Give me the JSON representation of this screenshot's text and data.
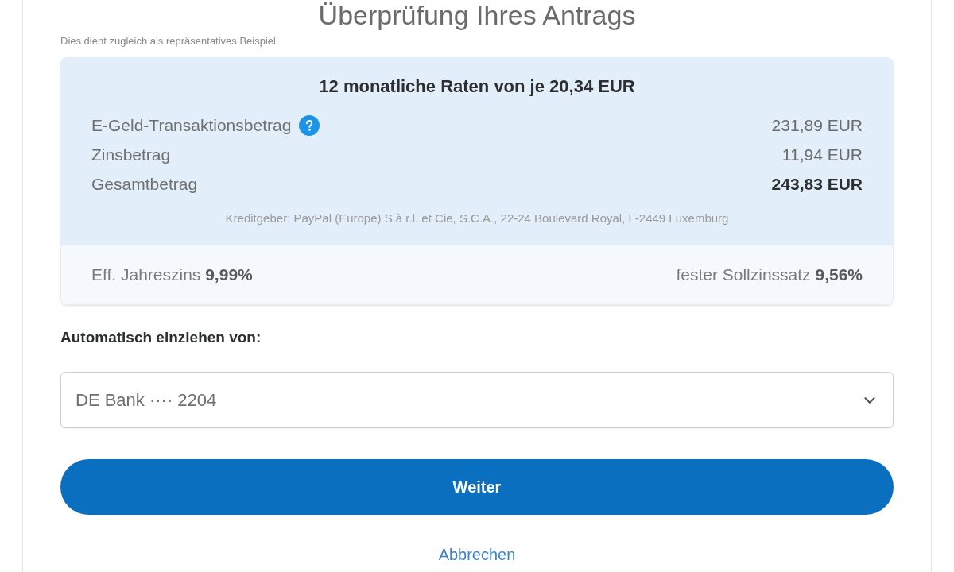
{
  "page": {
    "title": "Überprüfung Ihres Antrags",
    "subtitle": "Dies dient zugleich als repräsentatives Beispiel."
  },
  "summary": {
    "heading": "12 monatliche Raten von je 20,34 EUR",
    "rows": [
      {
        "kind": "info",
        "label": "E-Geld-Transaktionsbetrag",
        "value": "231,89 EUR"
      },
      {
        "kind": "plain",
        "label": "Zinsbetrag",
        "value": "11,94 EUR"
      },
      {
        "kind": "total",
        "label": "Gesamtbetrag",
        "value": "243,83 EUR"
      }
    ],
    "lender": "Kreditgeber: PayPal (Europe) S.à r.l. et Cie, S.C.A., 22-24 Boulevard Royal, L-2449 Luxemburg",
    "rates": [
      {
        "label": "Eff. Jahreszins",
        "value": "9,99%"
      },
      {
        "label": "fester Sollzinssatz",
        "value": "9,56%"
      }
    ]
  },
  "debit": {
    "label": "Automatisch einziehen von:",
    "value": "DE Bank ···· 2204"
  },
  "actions": {
    "continue": "Weiter",
    "cancel": "Abbrechen"
  }
}
